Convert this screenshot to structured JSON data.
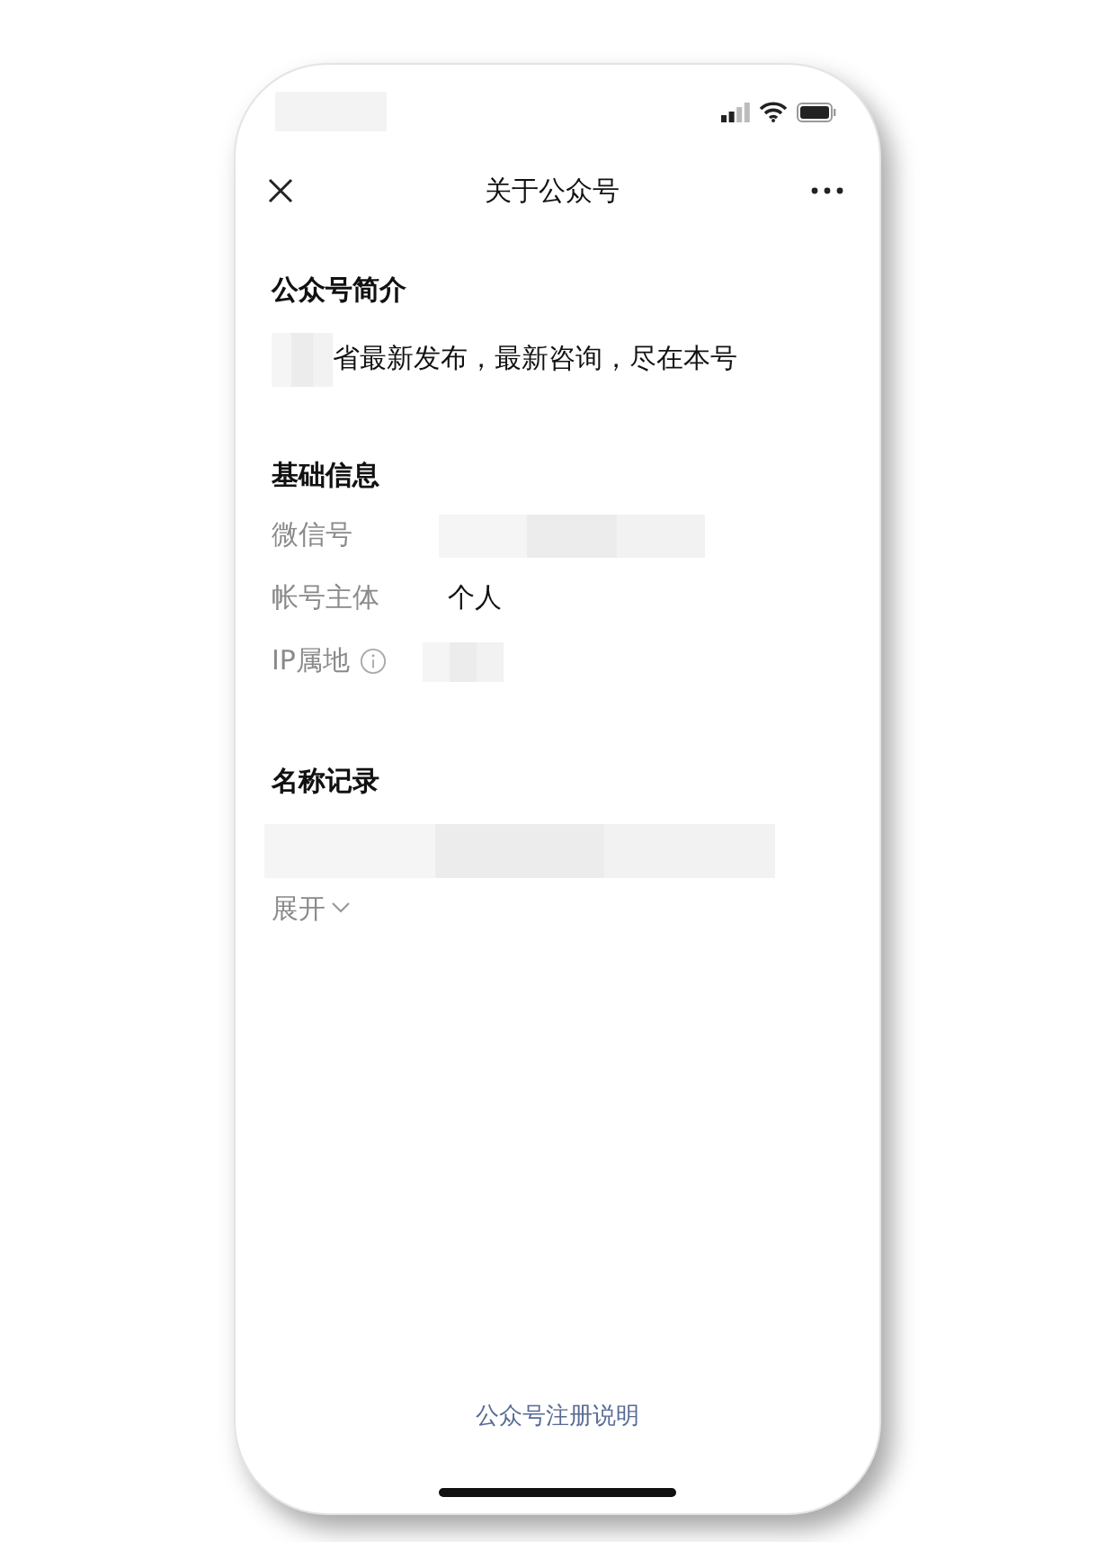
{
  "nav": {
    "title": "关于公众号"
  },
  "intro": {
    "heading": "公众号简介",
    "text": "省最新发布，最新咨询，尽在本号"
  },
  "basic_info": {
    "heading": "基础信息",
    "rows": [
      {
        "label": "微信号",
        "kind": "blurred"
      },
      {
        "label": "帐号主体",
        "kind": "text",
        "value": "个人"
      },
      {
        "label": "IP属地",
        "kind": "blurred_info"
      }
    ]
  },
  "name_history": {
    "heading": "名称记录",
    "expand": "展开"
  },
  "footer_link": "公众号注册说明"
}
